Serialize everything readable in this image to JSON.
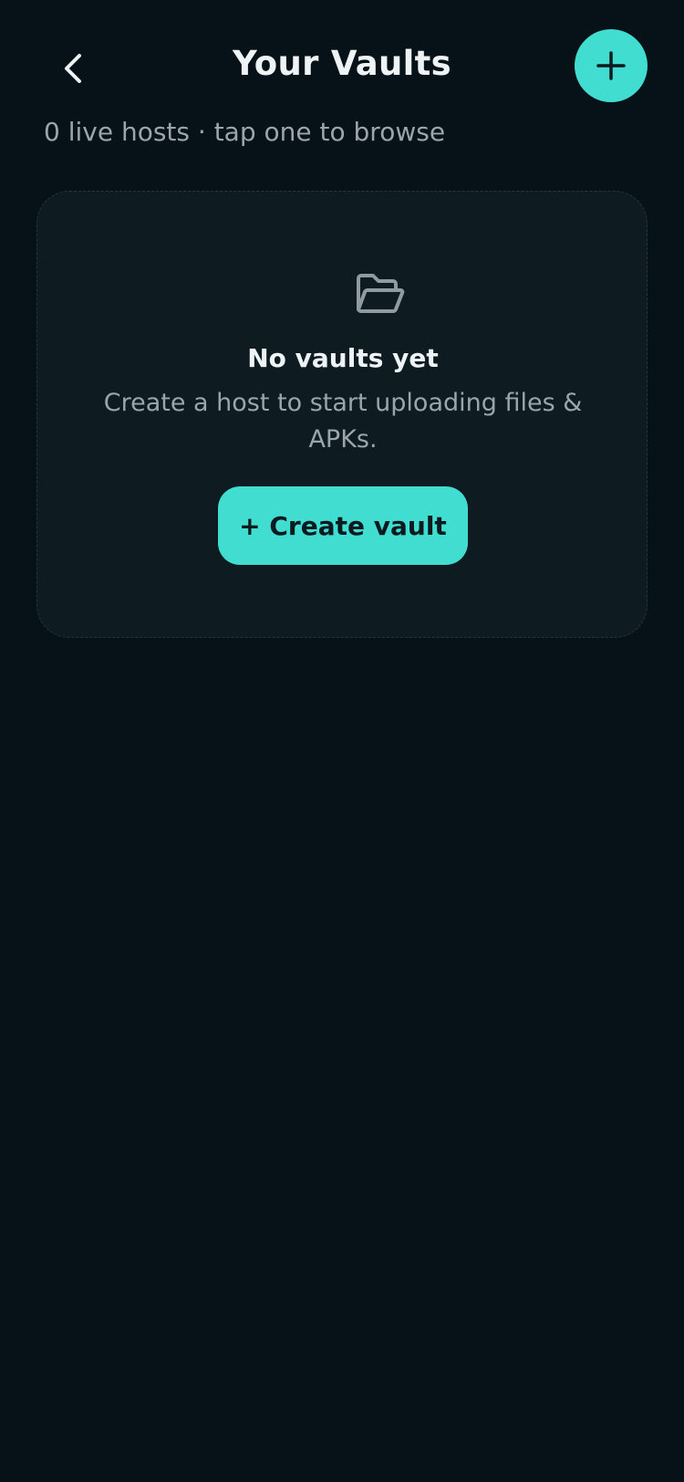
{
  "header": {
    "title": "Your Vaults",
    "back_icon": "chevron-left-icon",
    "add_icon": "plus-icon"
  },
  "subtitle": "0 live hosts · tap one to browse",
  "empty_state": {
    "icon": "folder-open-icon",
    "title": "No vaults yet",
    "description": "Create a host to start uploading files & APKs.",
    "button_label": "+ Create vault"
  },
  "colors": {
    "background": "#071118",
    "card": "#0e1b21",
    "accent": "#40ddd0",
    "text_primary": "#eef4f5",
    "text_secondary": "#9aa6ab"
  }
}
